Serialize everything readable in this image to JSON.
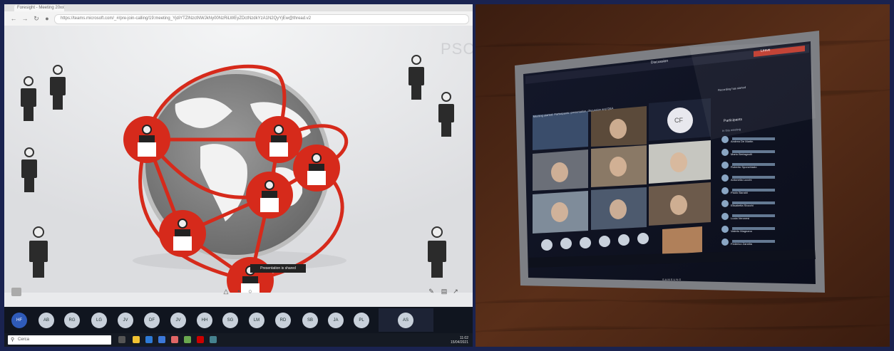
{
  "left_screenshot": {
    "browser": {
      "tab_title": "Foresight - Meeting 20xx",
      "address": "https://teams.microsoft.com/_#/pre-join-calling/19:meeting_YjdiYTZlNzctNWJkNy00NzRiLWEyZDctNzdkYzA1N2QyYjEw@thread.v2"
    },
    "watermark": "PSC",
    "caption": "Presentation is shared",
    "participants": [
      "HF",
      "AB",
      "RG",
      "LG",
      "JV",
      "DF",
      "JV",
      "HH",
      "SG",
      "LM",
      "RD",
      "SB",
      "JA",
      "PL"
    ],
    "host_chip": "AS",
    "taskbar": {
      "search_placeholder": "Cerca",
      "clock_time": "11:02",
      "clock_date": "15/04/2021"
    }
  },
  "right_photo": {
    "screen": {
      "top_label": "Discussion",
      "leave_button": "Leave",
      "banner": "Meeting started. Participants: presentation, discussion and Q&A",
      "notice": "Recording has started",
      "roster_title": "Participants",
      "roster_section": "In this meeting",
      "cf_initials": "CF",
      "roster": [
        "Andrea De Martin",
        "Mario Bertagnolli",
        "Roberto Sponchiado",
        "Antonella Lucchi",
        "Paolo Baraldi",
        "Elisabetta Stocchi",
        "Lucia Veronesi",
        "Valerio Magnano",
        "Federico Zanella"
      ],
      "brand": "SAMSUNG"
    }
  },
  "colors": {
    "network_red": "#d62a1b",
    "frame_navy": "#1a2350",
    "wall_brown": "#4a2717"
  }
}
